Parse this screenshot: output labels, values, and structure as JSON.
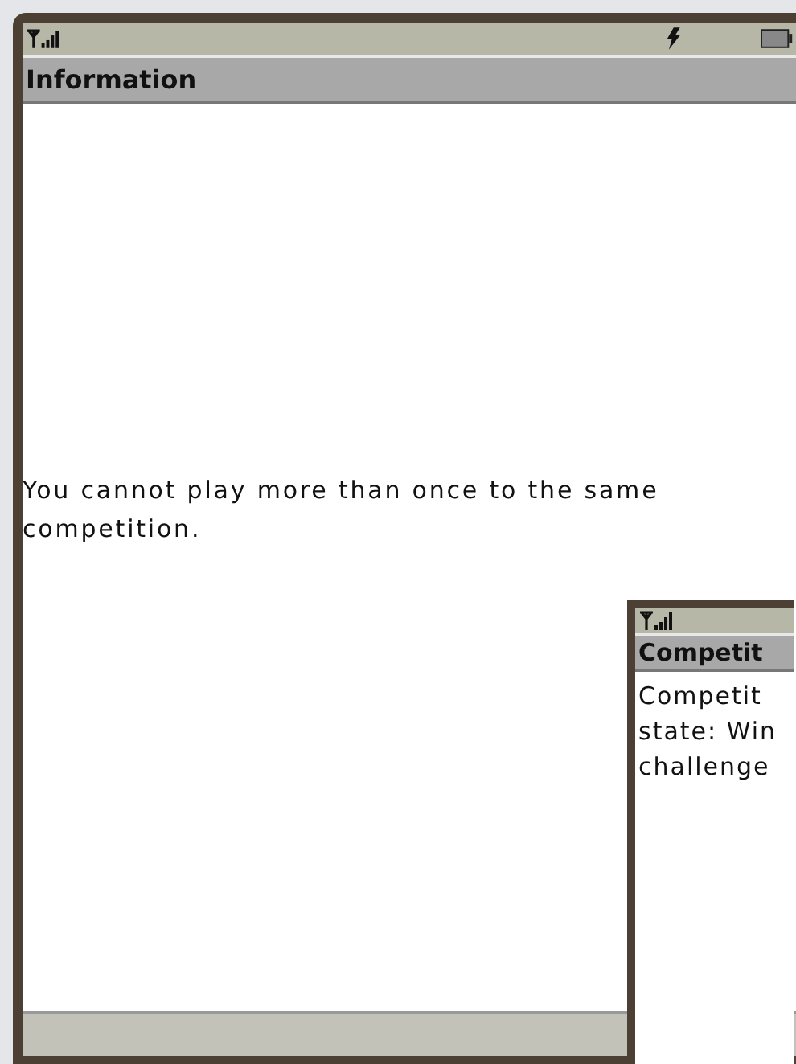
{
  "windows": [
    {
      "status_icons": [
        {
          "kind": "signal"
        },
        {
          "kind": "charging"
        },
        {
          "kind": "battery"
        }
      ],
      "title": "Information",
      "lines": [
        "You cannot play more than once to the same competition."
      ],
      "softkey_bar": true
    },
    {
      "status_icons": [
        {
          "kind": "signal"
        }
      ],
      "title": "Competit",
      "lines": [
        "Competit",
        "state: Win",
        "challenge"
      ],
      "softkey_bar": false
    }
  ]
}
